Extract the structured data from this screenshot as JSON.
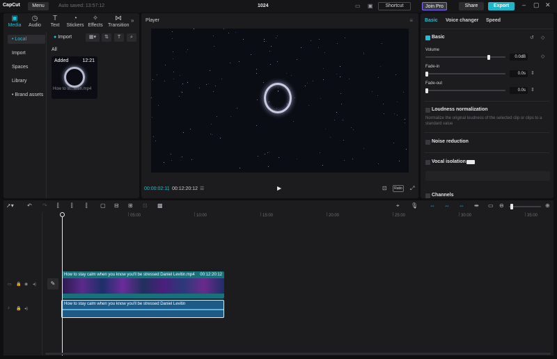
{
  "titlebar": {
    "logo": "CapCut",
    "menu": "Menu",
    "autosave": "Auto saved: 13:57:12",
    "project_title": "1024",
    "shortcut": "Shortcut",
    "join_pro": "Join Pro",
    "share": "Share",
    "export": "Export"
  },
  "media_tabs": [
    {
      "label": "Media",
      "icon": "media-icon"
    },
    {
      "label": "Audio",
      "icon": "audio-icon"
    },
    {
      "label": "Text",
      "icon": "text-icon"
    },
    {
      "label": "Stickers",
      "icon": "stickers-icon"
    },
    {
      "label": "Effects",
      "icon": "effects-icon"
    },
    {
      "label": "Transition",
      "icon": "transition-icon"
    }
  ],
  "media_side": [
    "• Local",
    "Import",
    "Spaces",
    "Library",
    "• Brand assets"
  ],
  "media": {
    "import_label": "Import",
    "all_label": "All",
    "thumb_added": "Added",
    "thumb_duration": "12:21",
    "thumb_name": "How to st...witin.mp4"
  },
  "player": {
    "label": "Player",
    "current_time": "00:00:02:11",
    "total_time": "00:12:20:12",
    "ratio": "Ratio"
  },
  "right_tabs": [
    "Basic",
    "Voice changer",
    "Speed"
  ],
  "basic": {
    "section": "Basic",
    "volume_label": "Volume",
    "volume_value": "0.0dB",
    "volume_level": 0.8,
    "fadein_label": "Fade-in",
    "fadein_value": "0.0s",
    "fadeout_label": "Fade-out",
    "fadeout_value": "0.0s",
    "loudness_label": "Loudness normalization",
    "loudness_desc": "Normalize the original loudness of the selected clip or clips to a standard value",
    "noise_label": "Noise reduction",
    "vocal_label": "Vocal isolation",
    "channels_label": "Channels"
  },
  "ruler": [
    "00:00",
    "05:00",
    "10:00",
    "15:00",
    "20:00",
    "25:00",
    "30:00",
    "35:00"
  ],
  "video_clip": {
    "title": "How to stay calm when you know you'll be stressed  Daniel Levitin.mp4",
    "duration": "00:12:20:12"
  },
  "audio_clip": {
    "title": "How to stay calm when you know you'll be stressed  Daniel Levitin"
  },
  "colors": {
    "accent": "#1ec0d4",
    "video_clip": "#18707a",
    "audio_clip": "#1d5b86"
  }
}
